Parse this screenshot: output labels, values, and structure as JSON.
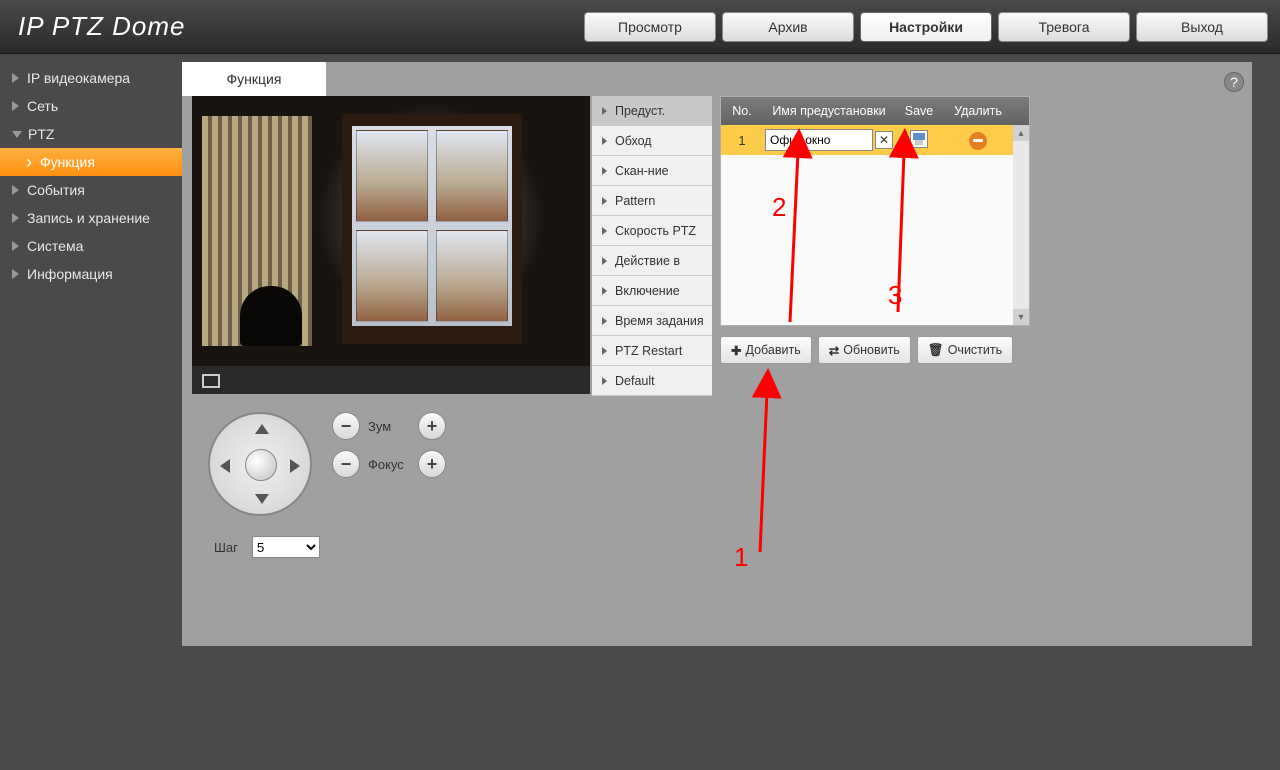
{
  "logo": "IP PTZ Dome",
  "top_nav": {
    "preview": "Просмотр",
    "archive": "Архив",
    "settings": "Настройки",
    "alarm": "Тревога",
    "logout": "Выход"
  },
  "sidebar": {
    "items": [
      {
        "label": "IP видеокамера"
      },
      {
        "label": "Сеть"
      },
      {
        "label": "PTZ",
        "expanded": true
      },
      {
        "label": "События"
      },
      {
        "label": "Запись и хранение"
      },
      {
        "label": "Система"
      },
      {
        "label": "Информация"
      }
    ],
    "sub_function": "Функция"
  },
  "tab": {
    "function": "Функция"
  },
  "ptz": {
    "zoom_label": "Зум",
    "focus_label": "Фокус",
    "step_label": "Шаг",
    "step_value": "5"
  },
  "func_list": [
    "Предуст.",
    "Обход",
    "Скан-ние",
    "Pattern",
    "Скорость PTZ",
    "Действие в",
    "Включение",
    "Время задания",
    "PTZ Restart",
    "Default"
  ],
  "preset_table": {
    "headers": {
      "no": "No.",
      "name": "Имя предустановки",
      "save": "Save",
      "delete": "Удалить"
    },
    "row": {
      "no": "1",
      "name": "Офис окно"
    }
  },
  "buttons": {
    "add": "Добавить",
    "refresh": "Обновить",
    "clear": "Очистить"
  },
  "annotations": {
    "one": "1",
    "two": "2",
    "three": "3"
  }
}
